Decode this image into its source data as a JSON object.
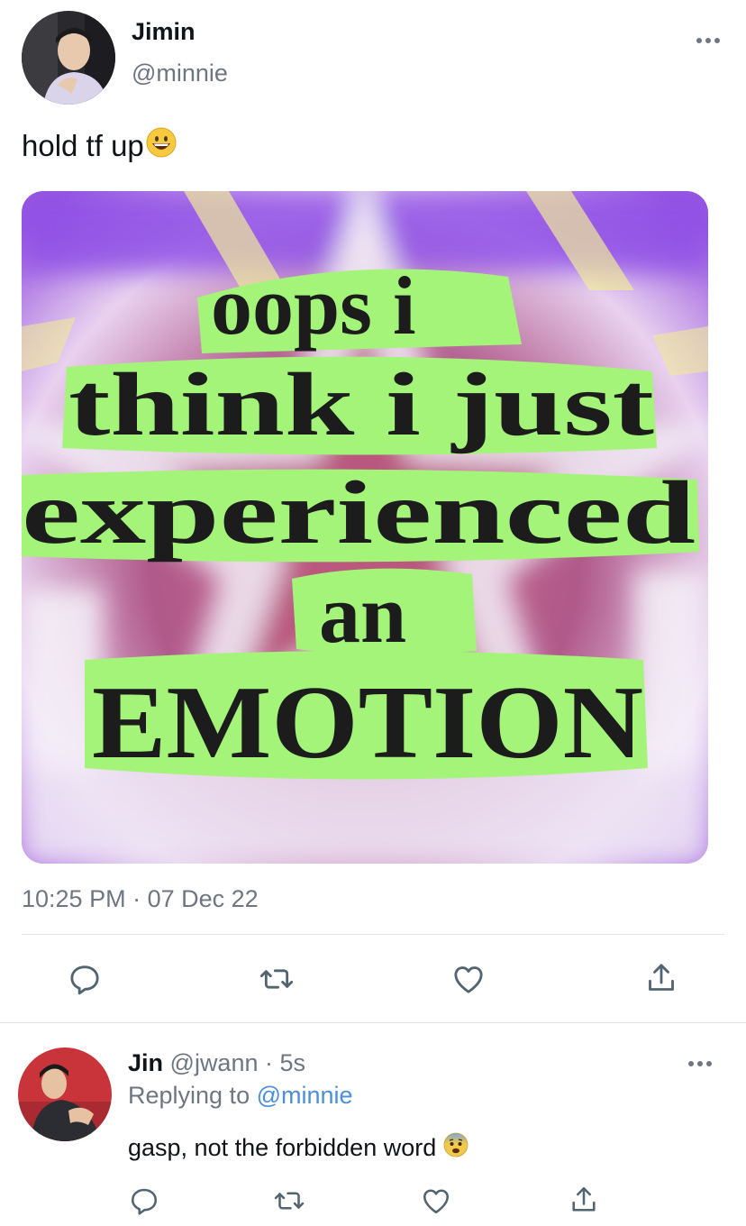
{
  "tweet": {
    "author_name": "Jimin",
    "author_handle": "@minnie",
    "text": "hold tf up",
    "emoji": "grinning-face",
    "media": {
      "lines": [
        "oops i",
        "think i just",
        "experienced",
        "an",
        "EMOTION"
      ]
    },
    "time": "10:25 PM",
    "separator": "·",
    "date": "07 Dec 22"
  },
  "actions": [
    "reply-icon",
    "retweet-icon",
    "like-icon",
    "share-icon"
  ],
  "reply": {
    "author_name": "Jin",
    "author_handle": "@jwann",
    "separator": "·",
    "age": "5s",
    "replying_prefix": "Replying to",
    "replying_to": "@minnie",
    "text": "gasp, not the forbidden word",
    "emoji": "fearful-face"
  },
  "colors": {
    "link": "#4a8fd8",
    "secondary_text": "#6e7681",
    "meme_green": "#a4f47a",
    "meme_purple": "#9a5ae0"
  }
}
